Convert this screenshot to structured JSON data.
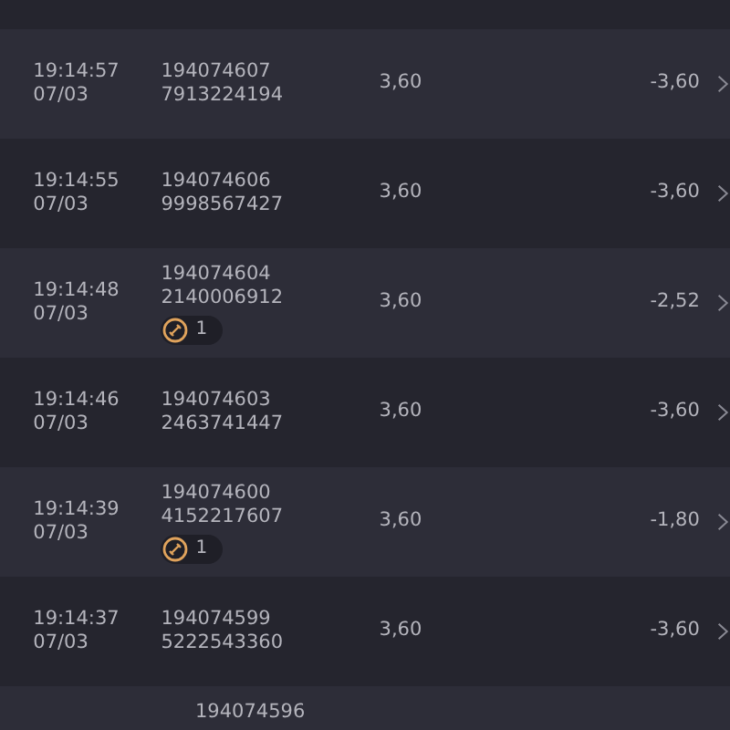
{
  "rows": [
    {
      "time": "19:14:57",
      "date": "07/03",
      "id": "194074607",
      "ref": "7913224194",
      "stake": "3,60",
      "result": "-3,60"
    },
    {
      "time": "19:14:55",
      "date": "07/03",
      "id": "194074606",
      "ref": "9998567427",
      "stake": "3,60",
      "result": "-3,60"
    },
    {
      "time": "19:14:48",
      "date": "07/03",
      "id": "194074604",
      "ref": "2140006912",
      "badge": "1",
      "stake": "3,60",
      "result": "-2,52"
    },
    {
      "time": "19:14:46",
      "date": "07/03",
      "id": "194074603",
      "ref": "2463741447",
      "stake": "3,60",
      "result": "-3,60"
    },
    {
      "time": "19:14:39",
      "date": "07/03",
      "id": "194074600",
      "ref": "4152217607",
      "badge": "1",
      "stake": "3,60",
      "result": "-1,80"
    },
    {
      "time": "19:14:37",
      "date": "07/03",
      "id": "194074599",
      "ref": "5222543360",
      "stake": "3,60",
      "result": "-3,60"
    }
  ],
  "partial_row": {
    "id": "194074596"
  }
}
